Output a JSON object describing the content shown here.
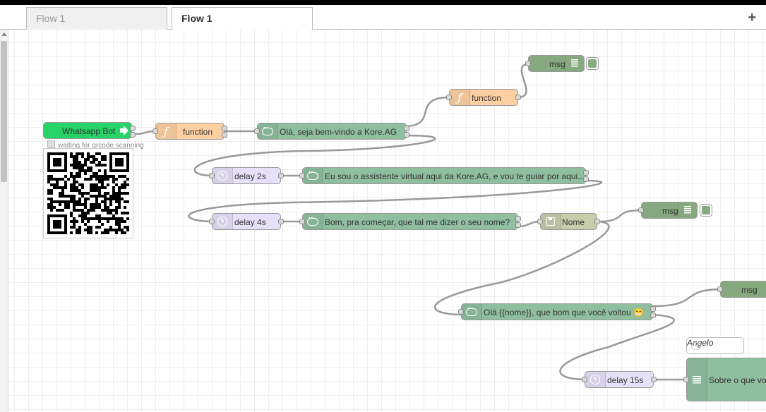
{
  "tabs": [
    {
      "label": "Flow 1",
      "active": false
    },
    {
      "label": "Flow 1",
      "active": true
    }
  ],
  "add_tab_label": "+",
  "colors": {
    "whatsapp": "#25d366",
    "function": "#fdd0a2",
    "chat": "#8fbf9f",
    "delay": "#e6e0f8",
    "change": "#c7ccaa",
    "debug": "#87a980",
    "wire": "#999999"
  },
  "nodes": {
    "whatsapp_bot": {
      "label": "Whatsapp Bot",
      "status": "waiting for qrcode scanning",
      "icon": "whatsapp-arrow-icon"
    },
    "function_1": {
      "label": "function",
      "icon": "function-icon"
    },
    "function_2": {
      "label": "function",
      "icon": "function-icon"
    },
    "welcome": {
      "label": "Olá, seja bem-vindo a Kore.AG",
      "icon": "chat-bubble-icon"
    },
    "debug_1": {
      "label": "msg",
      "icon": "debug-list-icon"
    },
    "delay_2s": {
      "label": "delay 2s",
      "icon": "clock-icon"
    },
    "assistant": {
      "label": "Eu sou o assistente virtual aqui da Kore.AG, e vou te guiar por aqui...",
      "icon": "chat-bubble-icon"
    },
    "delay_4s": {
      "label": "delay 4s",
      "icon": "clock-icon"
    },
    "ask_name": {
      "label": "Bom, pra começar, que tal me dizer o seu nome?",
      "icon": "chat-bubble-icon"
    },
    "nome": {
      "label": "Nome",
      "icon": "floppy-icon"
    },
    "debug_2": {
      "label": "msg",
      "icon": "debug-list-icon"
    },
    "greeting": {
      "label": "Olá {{nome}}, que bom que você voltou 😁",
      "icon": "chat-bubble-icon"
    },
    "debug_3": {
      "label": "msg",
      "icon": "debug-list-icon"
    },
    "comment": {
      "label": "Angelo",
      "icon": "comment-icon"
    },
    "delay_15s": {
      "label": "delay 15s",
      "icon": "clock-icon"
    },
    "about": {
      "label": "Sobre o que você",
      "icon": "menu-list-icon"
    }
  }
}
